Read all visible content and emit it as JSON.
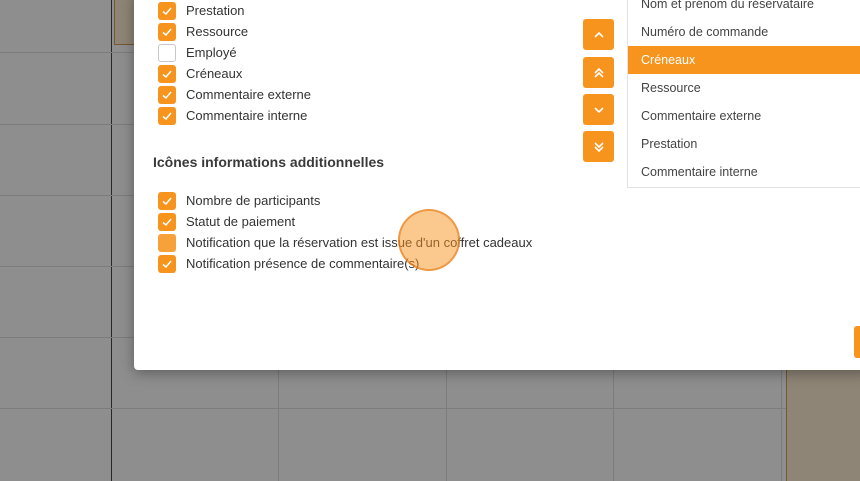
{
  "colors": {
    "accent": "#f7941d",
    "overlay": "rgba(0,0,0,0.42)"
  },
  "display_fields": [
    {
      "label": "Prestation",
      "checked": true
    },
    {
      "label": "Ressource",
      "checked": true
    },
    {
      "label": "Employé",
      "checked": false
    },
    {
      "label": "Créneaux",
      "checked": true
    },
    {
      "label": "Commentaire externe",
      "checked": true
    },
    {
      "label": "Commentaire interne",
      "checked": true
    }
  ],
  "additional_icons": {
    "title": "Icônes informations additionnelles",
    "items": [
      {
        "label": "Nombre de participants",
        "checked": true
      },
      {
        "label": "Statut de paiement",
        "checked": true
      },
      {
        "label": "Notification que la réservation est issue d'un coffret cadeaux",
        "checked": false
      },
      {
        "label": "Notification présence de commentaire(s)",
        "checked": true
      }
    ]
  },
  "order_buttons": [
    {
      "name": "move-up-icon"
    },
    {
      "name": "move-top-icon"
    },
    {
      "name": "move-down-icon"
    },
    {
      "name": "move-bottom-icon"
    }
  ],
  "order_list": {
    "selected": "Créneaux",
    "items": [
      "Nom et prénom du réservataire",
      "Numéro de commande",
      "Créneaux",
      "Ressource",
      "Commentaire externe",
      "Prestation",
      "Commentaire interne"
    ]
  }
}
